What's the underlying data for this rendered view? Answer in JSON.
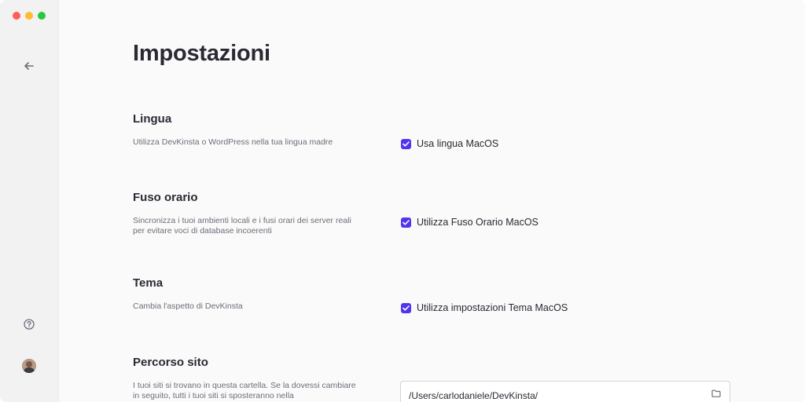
{
  "window": {
    "traffic_lights": {
      "close": "#ff5f57",
      "minimize": "#febc2e",
      "zoom": "#28c840"
    }
  },
  "sidebar": {
    "back_icon": "arrow-left-icon",
    "help_icon": "question-circle-icon",
    "avatar": "user-avatar"
  },
  "page": {
    "title": "Impostazioni"
  },
  "accent": "#5333ed",
  "sections": {
    "lingua": {
      "title": "Lingua",
      "description": "Utilizza DevKinsta o WordPress nella tua lingua madre",
      "checkbox_label": "Usa lingua MacOS",
      "checked": true
    },
    "fuso": {
      "title": "Fuso orario",
      "description": "Sincronizza i tuoi ambienti locali e i fusi orari dei server reali per evitare voci di database incoerenti",
      "checkbox_label": "Utilizza Fuso Orario MacOS",
      "checked": true
    },
    "tema": {
      "title": "Tema",
      "description": "Cambia l'aspetto di DevKinsta",
      "checkbox_label": "Utilizza impostazioni Tema MacOS",
      "checked": true
    },
    "percorso": {
      "title": "Percorso sito",
      "description": "I tuoi siti si trovano in questa cartella. Se la dovessi cambiare in seguito, tutti i tuoi siti si sposteranno nella",
      "path_value": "/Users/carlodaniele/DevKinsta/",
      "folder_icon": "folder-icon"
    }
  }
}
